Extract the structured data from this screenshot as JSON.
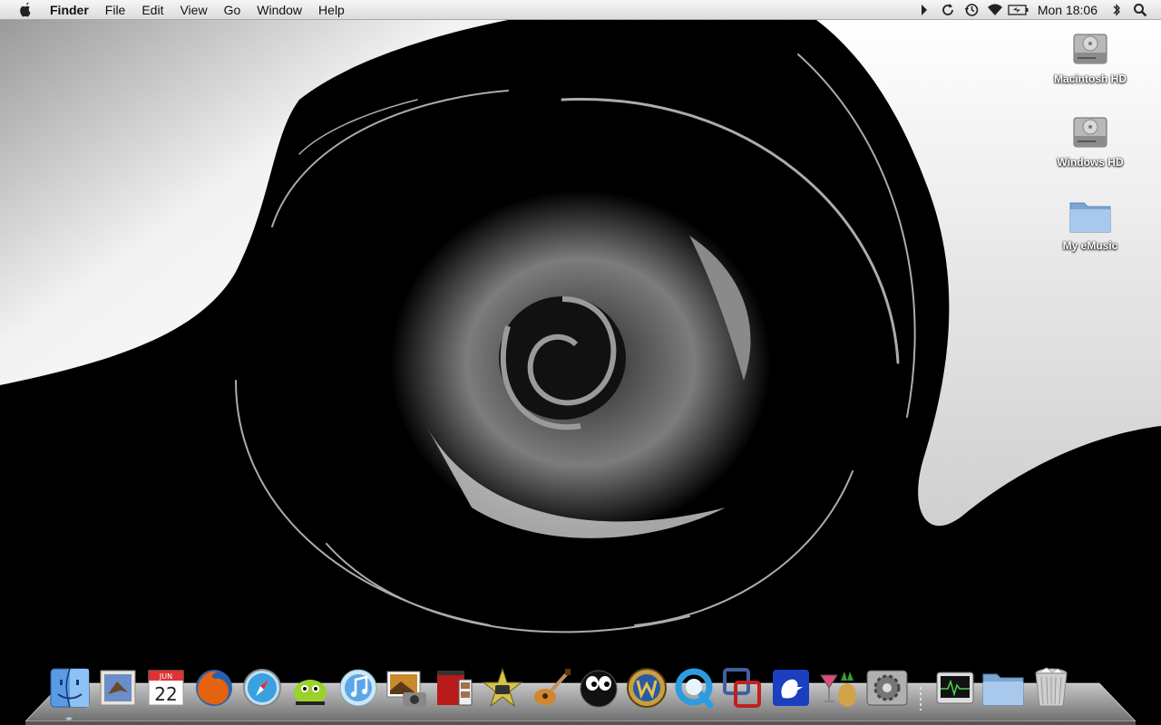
{
  "menubar": {
    "app_name": "Finder",
    "menus": [
      "File",
      "Edit",
      "View",
      "Go",
      "Window",
      "Help"
    ],
    "extras": [
      "chevron-icon",
      "sync-icon",
      "time-machine-icon",
      "wifi-icon",
      "battery-icon"
    ],
    "clock": "Mon 18:06",
    "trailing": [
      "bluetooth-icon",
      "spotlight-icon"
    ]
  },
  "desktop": {
    "icons": [
      {
        "label": "Macintosh HD",
        "type": "hard-drive-icon"
      },
      {
        "label": "Windows HD",
        "type": "hard-drive-icon"
      },
      {
        "label": "My eMusic",
        "type": "folder-icon"
      }
    ]
  },
  "dock": {
    "apps": [
      {
        "name": "finder-icon",
        "color": "#4a8fe0",
        "running": true
      },
      {
        "name": "mail-icon",
        "color": "#6a8ec9"
      },
      {
        "name": "ical-icon",
        "color": "#d33",
        "text_month": "JUN",
        "text_day": "22"
      },
      {
        "name": "firefox-icon",
        "color": "#e5620f"
      },
      {
        "name": "safari-icon",
        "color": "#3aa0e0"
      },
      {
        "name": "adium-icon",
        "color": "#9bd12a"
      },
      {
        "name": "itunes-icon",
        "color": "#5aa8e8"
      },
      {
        "name": "iphoto-icon",
        "color": "#c98a2b"
      },
      {
        "name": "photo-booth-icon",
        "color": "#b81a1a"
      },
      {
        "name": "imovie-icon",
        "color": "#d8c34a"
      },
      {
        "name": "garageband-icon",
        "color": "#d0872d"
      },
      {
        "name": "eyes-app-icon",
        "color": "#222"
      },
      {
        "name": "world-of-warcraft-icon",
        "color": "#2c5aa0"
      },
      {
        "name": "quicktime-icon",
        "color": "#2c9be0"
      },
      {
        "name": "vmware-icon",
        "color": "#c02020"
      },
      {
        "name": "cyberduck-icon",
        "color": "#1b3fbf"
      },
      {
        "name": "cocktail-icon",
        "color": "#d1a34a"
      },
      {
        "name": "system-preferences-icon",
        "color": "#8c8c8c"
      }
    ],
    "docs": [
      {
        "name": "activity-monitor-icon",
        "color": "#3a8a3a"
      },
      {
        "name": "documents-folder-icon",
        "color": "#8fb5dd"
      },
      {
        "name": "trash-icon",
        "color": "#cccccc"
      }
    ]
  }
}
